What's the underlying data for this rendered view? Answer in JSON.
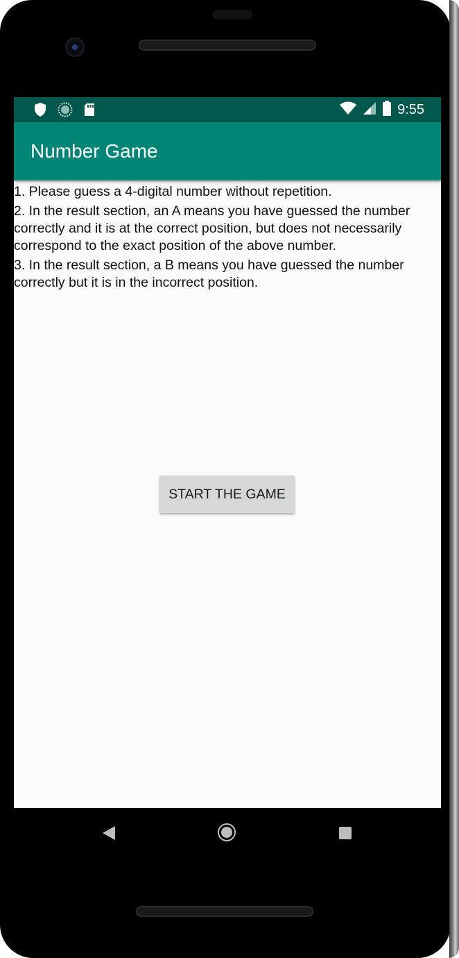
{
  "status_bar": {
    "time": "9:55",
    "left_icons": [
      "shield-icon",
      "sync-icon",
      "sd-card-icon"
    ],
    "right_icons": [
      "wifi-icon",
      "signal-icon",
      "battery-icon"
    ]
  },
  "app_bar": {
    "title": "Number Game"
  },
  "rules": [
    "1. Please guess a 4-digital number without repetition.",
    "2. In the result section, an A means you have guessed the number correctly and it is at the correct position, but does not necessarily correspond to the exact position of the above number.",
    "3. In the result section, a B means you have guessed the number correctly but it is in the incorrect position."
  ],
  "start_button": {
    "label": "START THE GAME"
  },
  "nav_bar": {
    "icons": [
      "back-icon",
      "home-icon",
      "recent-apps-icon"
    ]
  },
  "colors": {
    "status_bar": "#00574b",
    "app_bar": "#008577",
    "screen_background": "#fafafa",
    "button": "#d6d7d7"
  }
}
